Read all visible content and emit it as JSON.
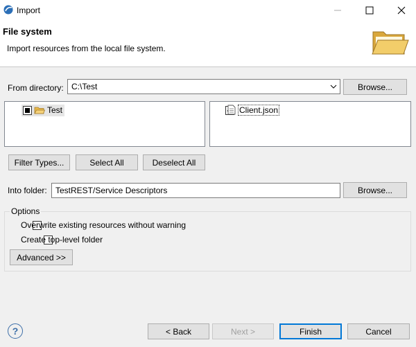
{
  "window": {
    "title": "Import",
    "controls": {
      "minimize_icon": "minimize-icon",
      "maximize_icon": "maximize-icon",
      "close_icon": "close-icon"
    }
  },
  "header": {
    "title": "File system",
    "description": "Import resources from the local file system.",
    "icon": "folder-open-icon"
  },
  "source": {
    "label": "From directory:",
    "value": "C:\\Test",
    "browse_label": "Browse..."
  },
  "tree": {
    "items": [
      {
        "label": "Test",
        "state": "partial",
        "icon": "folder-open-icon"
      }
    ]
  },
  "files": {
    "items": [
      {
        "label": "Client.json",
        "checked": true,
        "icon": "file-icon"
      }
    ]
  },
  "selection_buttons": {
    "filter_types": "Filter Types...",
    "select_all": "Select All",
    "deselect_all": "Deselect All"
  },
  "destination": {
    "label": "Into folder:",
    "value": "TestREST/Service Descriptors",
    "browse_label": "Browse..."
  },
  "options": {
    "title": "Options",
    "overwrite_label": "Overwrite existing resources without warning",
    "overwrite_checked": false,
    "create_top_level_label": "Create top-level folder",
    "create_top_level_checked": false,
    "advanced_label": "Advanced >>"
  },
  "footer": {
    "help_label": "?",
    "back_label": "< Back",
    "next_label": "Next >",
    "finish_label": "Finish",
    "cancel_label": "Cancel"
  },
  "colors": {
    "accent": "#0078d7",
    "folder": "#e8b84a"
  }
}
